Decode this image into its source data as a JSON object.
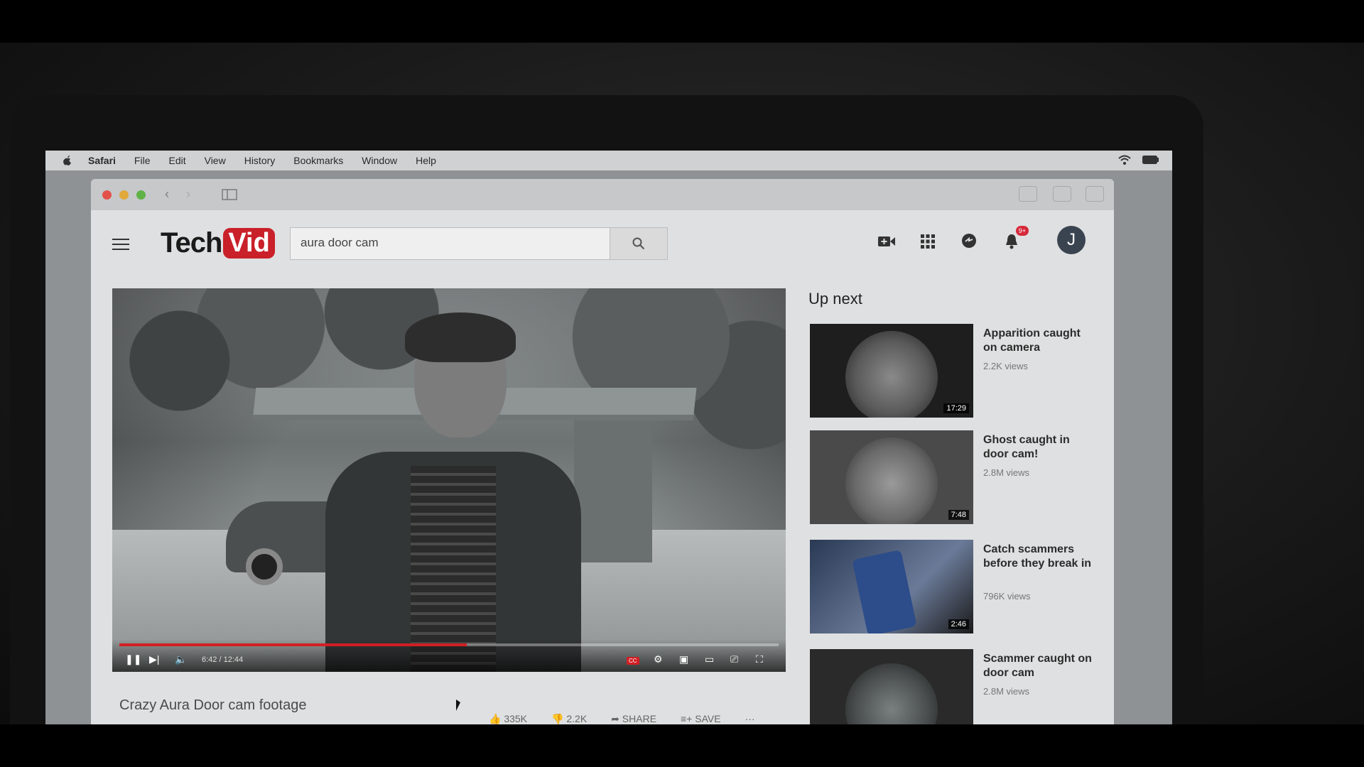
{
  "menubar": {
    "app": "Safari",
    "items": [
      "File",
      "Edit",
      "View",
      "History",
      "Bookmarks",
      "Window",
      "Help"
    ]
  },
  "site": {
    "logo_part1": "Tech",
    "logo_part2": "Vid",
    "accent_color": "#c9202a"
  },
  "search": {
    "value": "aura door cam"
  },
  "header": {
    "notification_badge": "9+",
    "avatar_letter": "J"
  },
  "player": {
    "time": "6:42 / 12:44",
    "progress_fraction": 0.527,
    "cc_label": "CC"
  },
  "video": {
    "title": "Crazy Aura Door cam footage",
    "likes": "335K",
    "dislikes": "2.2K",
    "share_label": "SHARE",
    "save_label": "SAVE"
  },
  "upnext": {
    "title": "Up next",
    "items": [
      {
        "title": "Apparition caught on camera",
        "views": "2.2K views",
        "duration": "17:29"
      },
      {
        "title": "Ghost caught in door cam!",
        "views": "2.8M views",
        "duration": "7:48"
      },
      {
        "title": "Catch scammers before they break in",
        "views": "796K views",
        "duration": "2:46"
      },
      {
        "title": "Scammer caught on door cam",
        "views": "2.8M views",
        "duration": ""
      }
    ]
  }
}
